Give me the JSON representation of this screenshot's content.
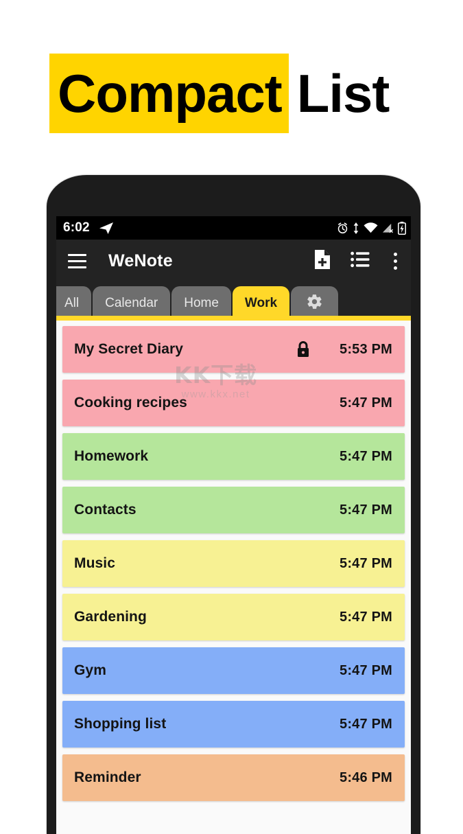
{
  "headline": {
    "highlighted": "Compact",
    "plain": "List",
    "highlight_color": "#FFD400"
  },
  "phone": {
    "statusbar": {
      "time": "6:02",
      "left_icons": [
        "telegram-send-icon"
      ],
      "right_icons": [
        "alarm-clock-icon",
        "data-transfer-icon",
        "wifi-icon",
        "cellular-signal-off-icon",
        "battery-charging-icon"
      ]
    },
    "appbar": {
      "menu_icon": "hamburger-menu-icon",
      "title": "WeNote",
      "actions": [
        "new-note-icon",
        "list-layout-icon",
        "overflow-menu-icon"
      ]
    },
    "tabs": {
      "items": [
        {
          "label": "All",
          "active": false
        },
        {
          "label": "Calendar",
          "active": false
        },
        {
          "label": "Home",
          "active": false
        },
        {
          "label": "Work",
          "active": true
        }
      ],
      "settings_tab": {
        "icon": "gear-icon",
        "label": ""
      },
      "active_color": "#FFD829",
      "inactive_color": "#6E6E6E"
    },
    "notes": [
      {
        "title": "My Secret Diary",
        "time": "5:53 PM",
        "color": "#F9A7AF",
        "locked": true
      },
      {
        "title": "Cooking recipes",
        "time": "5:47 PM",
        "color": "#F9A7AF",
        "locked": false
      },
      {
        "title": "Homework",
        "time": "5:47 PM",
        "color": "#B5E69B",
        "locked": false
      },
      {
        "title": "Contacts",
        "time": "5:47 PM",
        "color": "#B5E69B",
        "locked": false
      },
      {
        "title": "Music",
        "time": "5:47 PM",
        "color": "#F7F193",
        "locked": false
      },
      {
        "title": "Gardening",
        "time": "5:47 PM",
        "color": "#F7F193",
        "locked": false
      },
      {
        "title": "Gym",
        "time": "5:47 PM",
        "color": "#84AEF8",
        "locked": false
      },
      {
        "title": "Shopping list",
        "time": "5:47 PM",
        "color": "#84AEF8",
        "locked": false
      },
      {
        "title": "Reminder",
        "time": "5:46 PM",
        "color": "#F4BC8E",
        "locked": false
      }
    ]
  },
  "watermark": {
    "logo_text": "KK下载",
    "url_text": "www.kkx.net"
  }
}
